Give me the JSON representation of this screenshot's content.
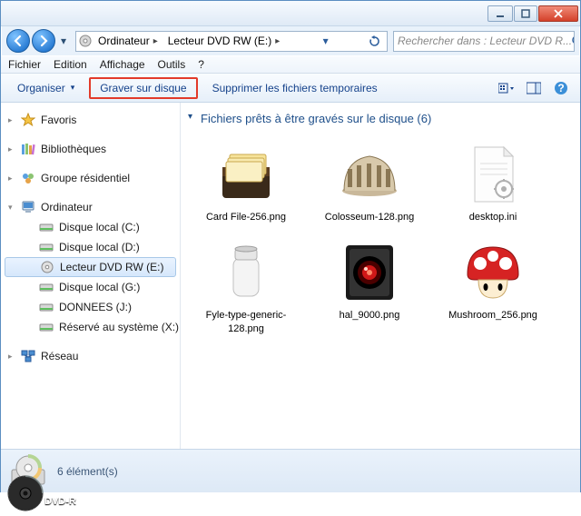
{
  "titlebar": {
    "minimize": "_",
    "maximize": "▢",
    "close": "✕"
  },
  "nav": {
    "breadcrumb": [
      "Ordinateur",
      "Lecteur DVD RW (E:)"
    ],
    "search_placeholder": "Rechercher dans : Lecteur DVD R..."
  },
  "menubar": [
    "Fichier",
    "Edition",
    "Affichage",
    "Outils",
    "?"
  ],
  "toolbar": {
    "organize": "Organiser",
    "burn": "Graver sur disque",
    "delete_temp": "Supprimer les fichiers temporaires"
  },
  "sidebar": {
    "favorites": "Favoris",
    "libraries": "Bibliothèques",
    "homegroup": "Groupe résidentiel",
    "computer": "Ordinateur",
    "drives": [
      "Disque local (C:)",
      "Disque local (D:)",
      "Lecteur DVD RW (E:)",
      "Disque local (G:)",
      "DONNEES (J:)",
      "Réservé au système (X:)"
    ],
    "network": "Réseau"
  },
  "content": {
    "section_title": "Fichiers prêts à être gravés sur le disque (6)",
    "files": [
      {
        "name": "Card File-256.png"
      },
      {
        "name": "Colosseum-128.png"
      },
      {
        "name": "desktop.ini"
      },
      {
        "name": "Fyle-type-generic-128.png"
      },
      {
        "name": "hal_9000.png"
      },
      {
        "name": "Mushroom_256.png"
      }
    ]
  },
  "statusbar": {
    "count": "6 élément(s)"
  },
  "footer": {
    "disc_label": "DVD-R"
  }
}
